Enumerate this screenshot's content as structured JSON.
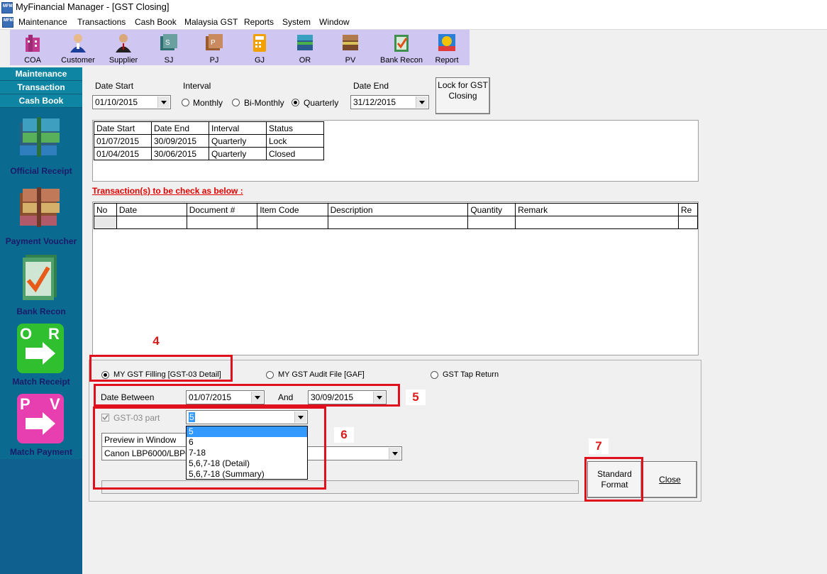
{
  "window": {
    "title": "MyFinancial Manager - [GST Closing]"
  },
  "menu": [
    "Maintenance",
    "Transactions",
    "Cash Book",
    "Malaysia GST",
    "Reports",
    "System",
    "Window"
  ],
  "toolbar": [
    {
      "label": "COA",
      "icon": "building-icon"
    },
    {
      "label": "Customer",
      "icon": "customer-icon"
    },
    {
      "label": "Supplier",
      "icon": "supplier-icon"
    },
    {
      "label": "SJ",
      "icon": "sales-journal-icon"
    },
    {
      "label": "PJ",
      "icon": "purchase-journal-icon"
    },
    {
      "label": "GJ",
      "icon": "general-journal-icon"
    },
    {
      "label": "OR",
      "icon": "official-receipt-icon"
    },
    {
      "label": "PV",
      "icon": "payment-voucher-icon"
    },
    {
      "label": "Bank Recon",
      "icon": "bank-recon-icon"
    },
    {
      "label": "Report",
      "icon": "report-icon"
    }
  ],
  "leftnav": {
    "headers": [
      "Maintenance",
      "Transaction",
      "Cash Book"
    ],
    "items": [
      "Official Receipt",
      "Payment Voucher",
      "Bank Recon",
      "Match Receipt",
      "Match Payment"
    ]
  },
  "form": {
    "date_start_label": "Date Start",
    "date_start": "01/10/2015",
    "interval_label": "Interval",
    "interval_options": [
      "Monthly",
      "Bi-Monthly",
      "Quarterly"
    ],
    "interval_selected": "Quarterly",
    "date_end_label": "Date End",
    "date_end": "31/12/2015",
    "lock_button": "Lock for GST Closing"
  },
  "closing_table": {
    "headers": [
      "Date Start",
      "Date End",
      "Interval",
      "Status"
    ],
    "rows": [
      [
        "01/07/2015",
        "30/09/2015",
        "Quarterly",
        "Lock"
      ],
      [
        "01/04/2015",
        "30/06/2015",
        "Quarterly",
        "Closed"
      ]
    ]
  },
  "transactions": {
    "title": "Transaction(s) to be check as below :",
    "headers": [
      "No",
      "Date",
      "Document #",
      "Item Code",
      "Description",
      "Quantity",
      "Remark",
      "Re"
    ]
  },
  "report": {
    "options": [
      "MY GST Filling [GST-03 Detail]",
      "MY GST Audit File [GAF]",
      "GST Tap Return"
    ],
    "selected": "MY GST Filling [GST-03 Detail]",
    "between_label": "Date Between",
    "date_from": "01/07/2015",
    "and_label": "And",
    "date_to": "30/09/2015",
    "gst_part_label": "GST-03 part",
    "gst_part_value": "5",
    "gst_part_options": [
      "5",
      "6",
      "7-18",
      "5,6,7-18 (Detail)",
      "5,6,7-18 (Summary)"
    ],
    "preview_value": "Preview in Window",
    "printer_value": "Canon LBP6000/LBP6018",
    "standard_button": "Standard Format",
    "close_button": "Close"
  },
  "annotations": [
    "4",
    "5",
    "6",
    "7"
  ],
  "colors": {
    "nav_bg": "#0a6a8f",
    "nav_header": "#0e86a3",
    "toolbar_bg": "#cfc6f2",
    "annotation": "#e0101e",
    "link_red": "#e00000"
  }
}
